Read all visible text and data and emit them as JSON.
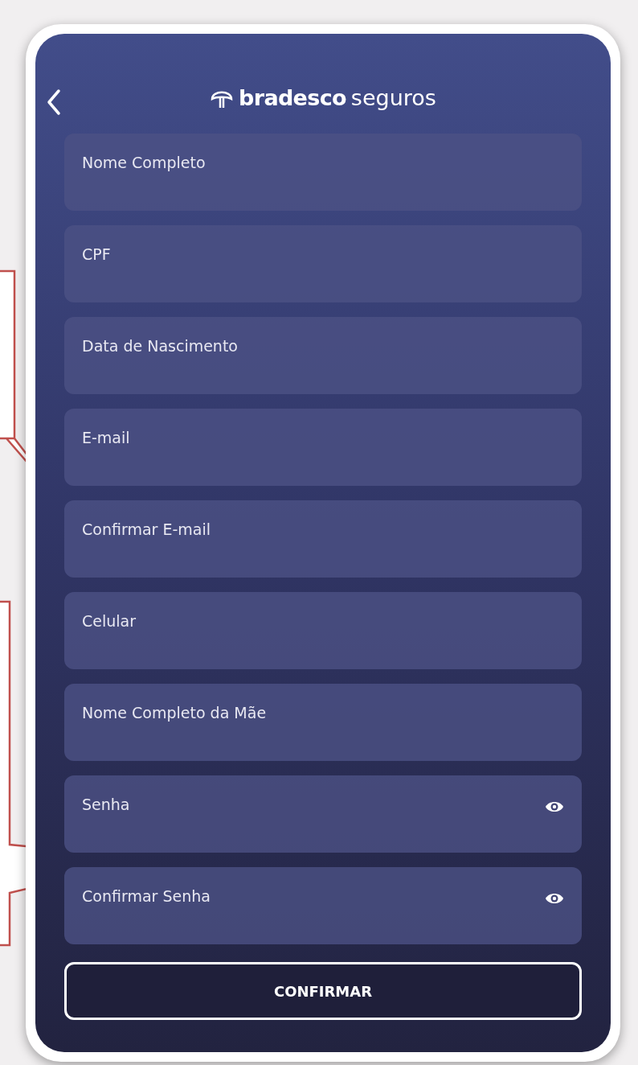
{
  "header": {
    "logo": {
      "brand": "bradesco",
      "suffix": "seguros"
    }
  },
  "fields": [
    {
      "placeholder": "Nome Completo",
      "kind": "text"
    },
    {
      "placeholder": "CPF",
      "kind": "text"
    },
    {
      "placeholder": "Data de Nascimento",
      "kind": "text"
    },
    {
      "placeholder": "E-mail",
      "kind": "text"
    },
    {
      "placeholder": "Confirmar E-mail",
      "kind": "text"
    },
    {
      "placeholder": "Celular",
      "kind": "text"
    },
    {
      "placeholder": "Nome Completo da Mãe",
      "kind": "text"
    },
    {
      "placeholder": "Senha",
      "kind": "password"
    },
    {
      "placeholder": "Confirmar Senha",
      "kind": "password"
    }
  ],
  "button": {
    "label": "CONFIRMAR"
  }
}
